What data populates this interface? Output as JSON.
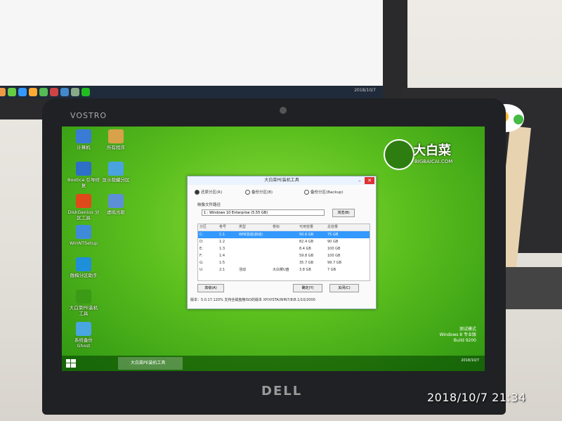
{
  "laptop": {
    "brand": "VOSTRO",
    "logo": "DELL"
  },
  "back_monitor": {
    "tray_text": "2018/10/7"
  },
  "desktop": {
    "icons": [
      {
        "label": "计算机",
        "color": "#3a7bd5"
      },
      {
        "label": "所有程序",
        "color": "#d7a24a"
      },
      {
        "label": "Bootice 引导修复",
        "color": "#2e6fc7"
      },
      {
        "label": "显示隐藏分区",
        "color": "#4aa3df"
      },
      {
        "label": "DiskGenius 分区工具",
        "color": "#e04a1a"
      },
      {
        "label": "虚拟光驱",
        "color": "#5c8fd6"
      },
      {
        "label": "WinNTSetup",
        "color": "#3f8bd9"
      },
      {
        "label": "傲梅分区助手",
        "color": "#1e8fd8"
      },
      {
        "label": "大白菜PE装机工具",
        "color": "#3b9a16"
      },
      {
        "label": "系统备份 Ghost",
        "color": "#4aa6e0"
      }
    ],
    "brand_name": "大白菜",
    "brand_url": "BIGBAICAI.COM",
    "watermark_lines": [
      "测试模式",
      "Windows 8 专业版",
      "Build 9200"
    ]
  },
  "dialog": {
    "title": "大白菜PE装机工具",
    "options": [
      "还原分区(R)",
      "备份分区(B)",
      "备份分区(Backup)"
    ],
    "image_label": "映像文件路径",
    "image_value": "1 : Windows 10 Enterprise (5.55 GB)",
    "browse_label": "浏览(B)",
    "columns": [
      "分区",
      "卷号",
      "类型",
      "卷标",
      "可用容量",
      "总容量"
    ],
    "rows": [
      [
        "C:",
        "1:1",
        "WIN活动(启动)",
        "",
        "50.6 GB",
        "75 GB"
      ],
      [
        "D:",
        "1:2",
        "",
        "",
        "82.4 GB",
        "90 GB"
      ],
      [
        "E:",
        "1:3",
        "",
        "",
        "8.4 GB",
        "100 GB"
      ],
      [
        "F:",
        "1:4",
        "",
        "",
        "59.8 GB",
        "100 GB"
      ],
      [
        "G:",
        "1:5",
        "",
        "",
        "35.7 GB",
        "99.7 GB"
      ],
      [
        "U:",
        "2:1",
        "活动",
        "大白菜U盘",
        "3.8 GB",
        "7 GB"
      ]
    ],
    "restore_button": "高级(A)",
    "ok_button": "确定(Y)",
    "cancel_button": "关闭(C)",
    "status": "版本：5.0.17.120%      支持全磁盘格ISO的版本      XP/VISTA/WIN7/8/8.1/10/2000"
  },
  "taskbar": {
    "app_label": "大白菜PE装机工具",
    "clock": "2018/10/7"
  },
  "photo_timestamp": "2018/10/7  21:34"
}
